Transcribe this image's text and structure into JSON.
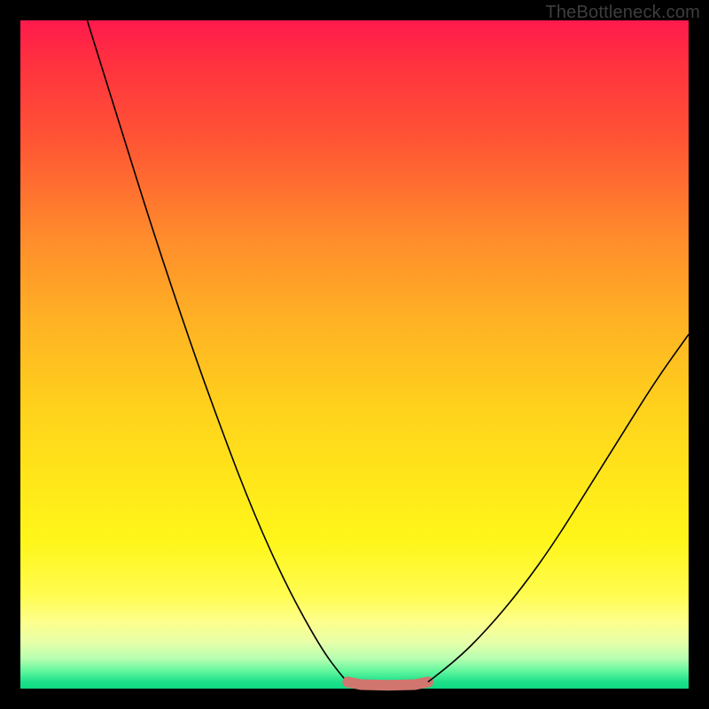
{
  "watermark": "TheBottleneck.com",
  "chart_data": {
    "type": "line",
    "title": "",
    "xlabel": "",
    "ylabel": "",
    "xlim": [
      0,
      100
    ],
    "ylim": [
      0,
      100
    ],
    "grid": false,
    "legend": false,
    "description": "Bottleneck curve: two descending branches meeting at a flat minimum near the bottom.",
    "series": [
      {
        "name": "left-branch",
        "x": [
          10,
          15,
          20,
          25,
          30,
          35,
          40,
          45,
          48,
          49
        ],
        "y": [
          100,
          84,
          68,
          53,
          39,
          26,
          15,
          6,
          2,
          1
        ],
        "color": "#000000",
        "stroke_width": 1.6
      },
      {
        "name": "flat-minimum",
        "x": [
          49,
          51,
          55,
          59,
          61
        ],
        "y": [
          1,
          0.6,
          0.5,
          0.6,
          1
        ],
        "color": "#d0766e",
        "stroke_width": 12
      },
      {
        "name": "right-branch",
        "x": [
          61,
          65,
          70,
          75,
          80,
          85,
          90,
          95,
          100
        ],
        "y": [
          1,
          4,
          9,
          15,
          22,
          30,
          38,
          46,
          53
        ],
        "color": "#000000",
        "stroke_width": 1.6
      }
    ],
    "flat_endpoints": {
      "left": {
        "x": 49,
        "y": 1
      },
      "right": {
        "x": 61,
        "y": 1
      },
      "dot_radius": 6,
      "color": "#d0766e"
    },
    "background_gradient": {
      "top": "#ff1a4d",
      "mid": "#ffe51a",
      "bottom": "#10d982"
    }
  }
}
